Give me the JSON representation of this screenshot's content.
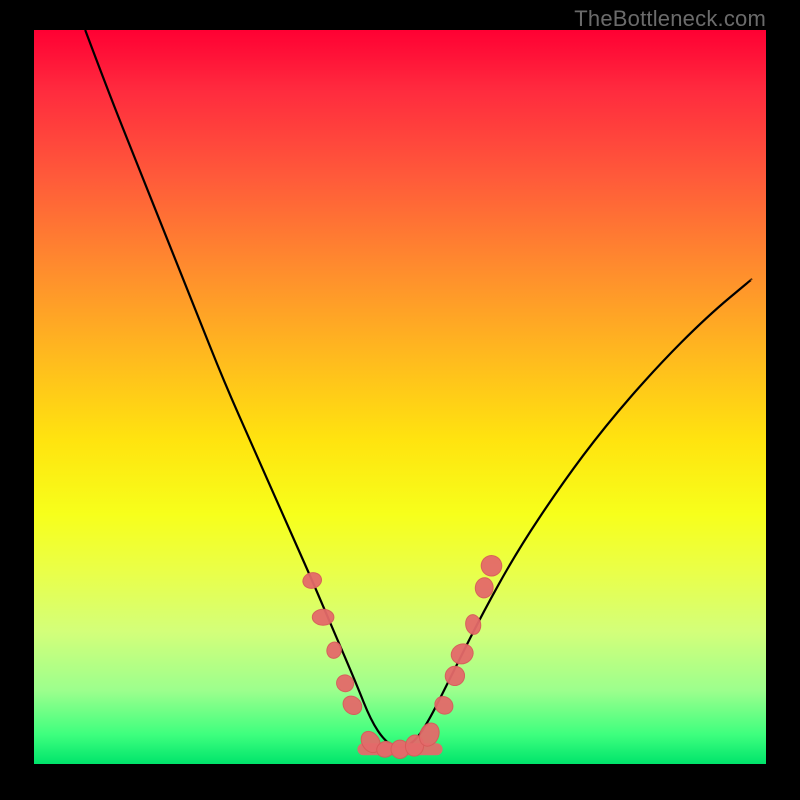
{
  "watermark": "TheBottleneck.com",
  "colors": {
    "frame": "#000000",
    "curve": "#000000",
    "blob": "#e46a6a",
    "gradient_top": "#ff0033",
    "gradient_bottom": "#00e46b"
  },
  "chart_data": {
    "type": "line",
    "title": "",
    "xlabel": "",
    "ylabel": "",
    "xlim": [
      0,
      100
    ],
    "ylim": [
      0,
      100
    ],
    "grid": false,
    "legend": false,
    "notes": "Unlabeled bottleneck-style V-curve on a vertical red→green gradient. Axes are unlabeled; x/y ranges are nominal 0–100. y≈0 is the green floor (no bottleneck), y≈100 is the red top. Curve values estimated from pixel positions. A cluster of salmon blobs sits near the valley floor and lower flanks.",
    "series": [
      {
        "name": "bottleneck_curve",
        "x": [
          7,
          10,
          14,
          18,
          22,
          26,
          30,
          34,
          38,
          41,
          44,
          46,
          48,
          50,
          52,
          54,
          57,
          61,
          66,
          72,
          78,
          85,
          92,
          98
        ],
        "y": [
          100,
          92,
          82,
          72,
          62,
          52,
          43,
          34,
          25,
          18,
          11,
          6,
          3,
          2,
          3,
          6,
          12,
          20,
          29,
          38,
          46,
          54,
          61,
          66
        ]
      }
    ],
    "blobs": {
      "name": "marker_cluster",
      "description": "Salmon-colored irregular dots near the valley of the curve.",
      "points_xy": [
        [
          38,
          25
        ],
        [
          39.5,
          20
        ],
        [
          41,
          15.5
        ],
        [
          42.5,
          11
        ],
        [
          43.5,
          8
        ],
        [
          46,
          3
        ],
        [
          48,
          2
        ],
        [
          50,
          2
        ],
        [
          52,
          2.5
        ],
        [
          54,
          4
        ],
        [
          56,
          8
        ],
        [
          57.5,
          12
        ],
        [
          58.5,
          15
        ],
        [
          60,
          19
        ],
        [
          61.5,
          24
        ],
        [
          62.5,
          27
        ]
      ]
    }
  }
}
